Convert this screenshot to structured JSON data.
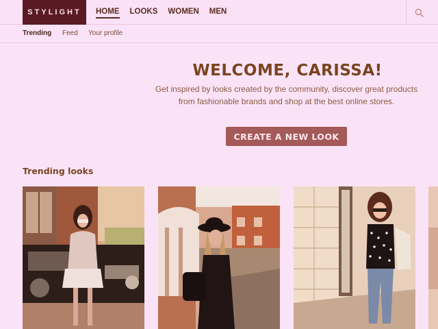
{
  "brand": {
    "logo_text": "STYLIGHT"
  },
  "main_nav": [
    {
      "label": "HOME",
      "active": true
    },
    {
      "label": "LOOKS",
      "active": false
    },
    {
      "label": "WOMEN",
      "active": false
    },
    {
      "label": "MEN",
      "active": false
    }
  ],
  "search": {
    "icon": "search-icon"
  },
  "sub_nav": [
    {
      "label": "Trending",
      "active": true
    },
    {
      "label": "Feed",
      "active": false
    },
    {
      "label": "Your profile",
      "active": false
    }
  ],
  "welcome": {
    "title": "WELCOME, CARISSA!",
    "text": "Get inspired by looks created by the community, discover great products from fashionable brands and shop at the best online stores.",
    "cta": "CREATE A NEW LOOK"
  },
  "trending": {
    "title": "Trending looks"
  },
  "colors": {
    "background": "#fbe3f7",
    "logo_bg": "#5a1a24",
    "accent": "#a45a58",
    "heading": "#7a4420"
  }
}
